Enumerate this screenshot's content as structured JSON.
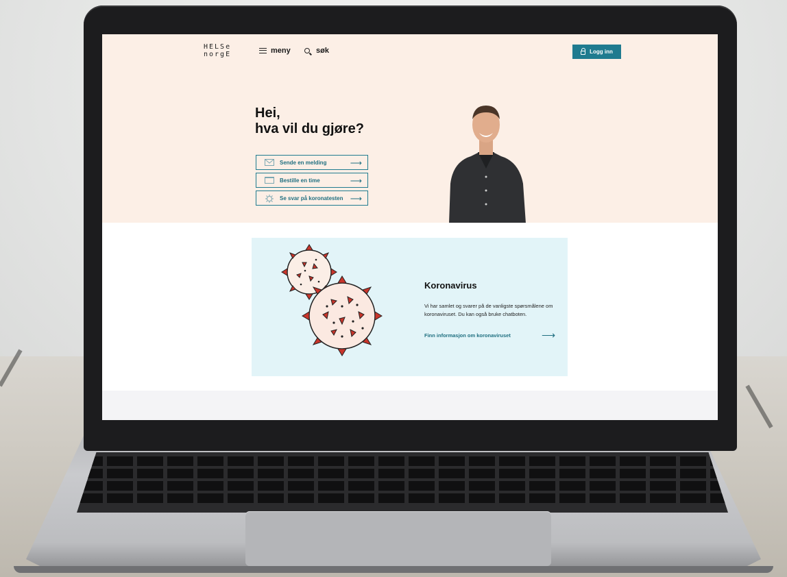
{
  "header": {
    "logo_line1": "HELSe",
    "logo_line2": "norgE",
    "menu_label": "meny",
    "search_label": "søk",
    "login_label": "Logg inn",
    "accent": "#1f7b8f"
  },
  "hero": {
    "greeting_line1": "Hei,",
    "greeting_line2": "hva vil du gjøre?",
    "background": "#fcefe6",
    "actions": [
      {
        "label": "Sende en melding",
        "icon": "envelope-icon"
      },
      {
        "label": "Bestille en time",
        "icon": "calendar-icon"
      },
      {
        "label": "Se svar på koronatesten",
        "icon": "virus-icon"
      }
    ]
  },
  "corona": {
    "title": "Koronavirus",
    "body": "Vi har samlet og svarer på de vanligste spørsmålene om koronaviruset. Du kan også bruke chatboten.",
    "link": "Finn informasjon om koronaviruset",
    "background": "#e2f4f8",
    "virus_color": "#c8352b"
  }
}
